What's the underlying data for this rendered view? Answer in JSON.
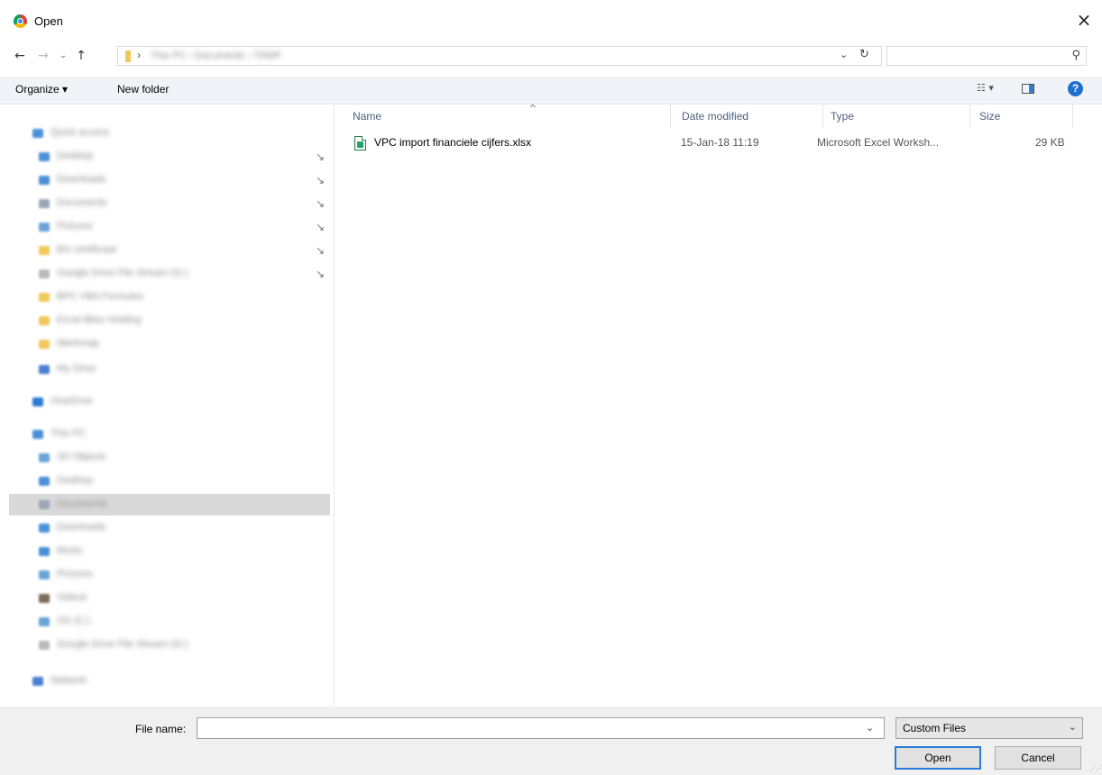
{
  "window": {
    "title": "Open",
    "close_icon": "close-icon"
  },
  "nav": {
    "back": "←",
    "forward": "→",
    "recent": "⌄",
    "up": "↑",
    "path_separator": "›",
    "address_path": "This PC  ›  Documents  ›  TEMP",
    "address_dropdown": "⌄",
    "refresh": "↻",
    "search_placeholder": "",
    "search_icon": "⚲"
  },
  "toolbar": {
    "organize_label": "Organize ▾",
    "new_folder_label": "New folder",
    "view_label": "☷ ▾",
    "help_label": "?"
  },
  "sidebar": {
    "items": [
      {
        "label": "Quick access",
        "color": "#4a90d9",
        "pinned": false,
        "indent": 0
      },
      {
        "label": "Desktop",
        "color": "#4a90d9",
        "pinned": true,
        "indent": 1
      },
      {
        "label": "Downloads",
        "color": "#4a90d9",
        "pinned": true,
        "indent": 1
      },
      {
        "label": "Documents",
        "color": "#9aa6b3",
        "pinned": true,
        "indent": 1
      },
      {
        "label": "Pictures",
        "color": "#6aa3d8",
        "pinned": true,
        "indent": 1
      },
      {
        "label": "BG certificaat",
        "color": "#f1c85a",
        "pinned": true,
        "indent": 1
      },
      {
        "label": "Google Drive File Stream (G:)",
        "color": "#bbbbbb",
        "pinned": true,
        "indent": 1
      },
      {
        "label": "BPC VBA Formules",
        "color": "#f1c85a",
        "pinned": false,
        "indent": 1
      },
      {
        "label": "Excel Bliss Holding",
        "color": "#f1c85a",
        "pinned": false,
        "indent": 1
      },
      {
        "label": "Werkmap",
        "color": "#f1c85a",
        "pinned": false,
        "indent": 1
      },
      {
        "label": "My Drive",
        "color": "#4a7fd4",
        "pinned": false,
        "indent": 1
      },
      {
        "label": "OneDrive",
        "color": "#2b7bd6",
        "pinned": false,
        "indent": 0
      },
      {
        "label": "This PC",
        "color": "#4a90d9",
        "pinned": false,
        "indent": 0
      },
      {
        "label": "3D Objects",
        "color": "#6aa3d8",
        "pinned": false,
        "indent": 1
      },
      {
        "label": "Desktop",
        "color": "#4a90d9",
        "pinned": false,
        "indent": 1
      },
      {
        "label": "Documents",
        "color": "#9aa6b3",
        "pinned": false,
        "indent": 1,
        "selected": true
      },
      {
        "label": "Downloads",
        "color": "#4a90d9",
        "pinned": false,
        "indent": 1
      },
      {
        "label": "Music",
        "color": "#4a90d9",
        "pinned": false,
        "indent": 1
      },
      {
        "label": "Pictures",
        "color": "#6aa3d8",
        "pinned": false,
        "indent": 1
      },
      {
        "label": "Videos",
        "color": "#7a6a5a",
        "pinned": false,
        "indent": 1
      },
      {
        "label": "OS (C:)",
        "color": "#6aa3d8",
        "pinned": false,
        "indent": 1
      },
      {
        "label": "Google Drive File Stream (G:)",
        "color": "#bbbbbb",
        "pinned": false,
        "indent": 1
      },
      {
        "label": "Network",
        "color": "#4a7fd4",
        "pinned": false,
        "indent": 0
      }
    ]
  },
  "content": {
    "sort_indicator": "^",
    "columns": [
      "Name",
      "Date modified",
      "Type",
      "Size"
    ],
    "files": [
      {
        "name": "VPC import financiele cijfers.xlsx",
        "date_modified": "15-Jan-18 11:19",
        "type": "Microsoft Excel Worksh...",
        "size": "29 KB",
        "icon": "excel-file-icon"
      }
    ]
  },
  "footer": {
    "filename_label": "File name:",
    "filename_value": "",
    "filename_dropdown": "⌄",
    "filetype_value": "Custom Files",
    "filetype_chevron": "⌄",
    "open_label": "Open",
    "cancel_label": "Cancel"
  },
  "colors": {
    "accent": "#2b7bd6",
    "toolbar_bg": "#f0f4f9",
    "footer_bg": "#f0f0f0",
    "selected_bg": "#d9d9d9"
  }
}
